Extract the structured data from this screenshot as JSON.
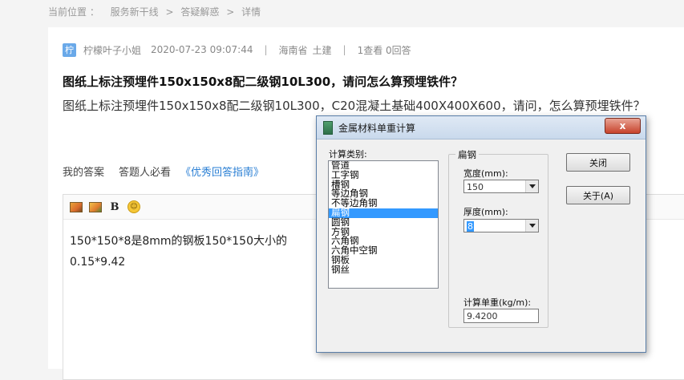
{
  "breadcrumb": {
    "prefix": "当前位置 ：",
    "items": [
      "服务新干线",
      "答疑解惑",
      "详情"
    ],
    "separator": ">"
  },
  "question": {
    "avatar_char": "柠",
    "author": "柠檬叶子小姐",
    "datetime": "2020-07-23 09:07:44",
    "region": "海南省",
    "category": "土建",
    "stats": "1查看  0回答",
    "title": "图纸上标注预埋件150x150x8配二级钢10L300，请问怎么算预埋铁件？",
    "body": "图纸上标注预埋件150x150x8配二级钢10L300，C20混凝土基础400X400X600，请问，怎么算预埋铁件？"
  },
  "answer_tabs": {
    "my_answer": "我的答案",
    "must_read": "答题人必看",
    "guide_link": "《优秀回答指南》"
  },
  "editor": {
    "bold_label": "B",
    "line1": "150*150*8是8mm的钢板150*150大小的",
    "line2": "0.15*9.42"
  },
  "dialog": {
    "title": "金属材料单重计算",
    "close_x": "x",
    "category_label": "计算类别:",
    "categories": [
      "管道",
      "工字钢",
      "槽钢",
      "等边角钢",
      "不等边角钢",
      "扁钢",
      "圆钢",
      "方钢",
      "六角钢",
      "六角中空钢",
      "钢板",
      "钢丝"
    ],
    "selected_category": "扁钢",
    "group_label": "扁钢",
    "width_label": "宽度(mm):",
    "width_value": "150",
    "thickness_label": "厚度(mm):",
    "thickness_value": "8",
    "result_label": "计算单重(kg/m):",
    "result_value": "9.4200",
    "close_button": "关闭",
    "about_button": "关于(A)"
  }
}
